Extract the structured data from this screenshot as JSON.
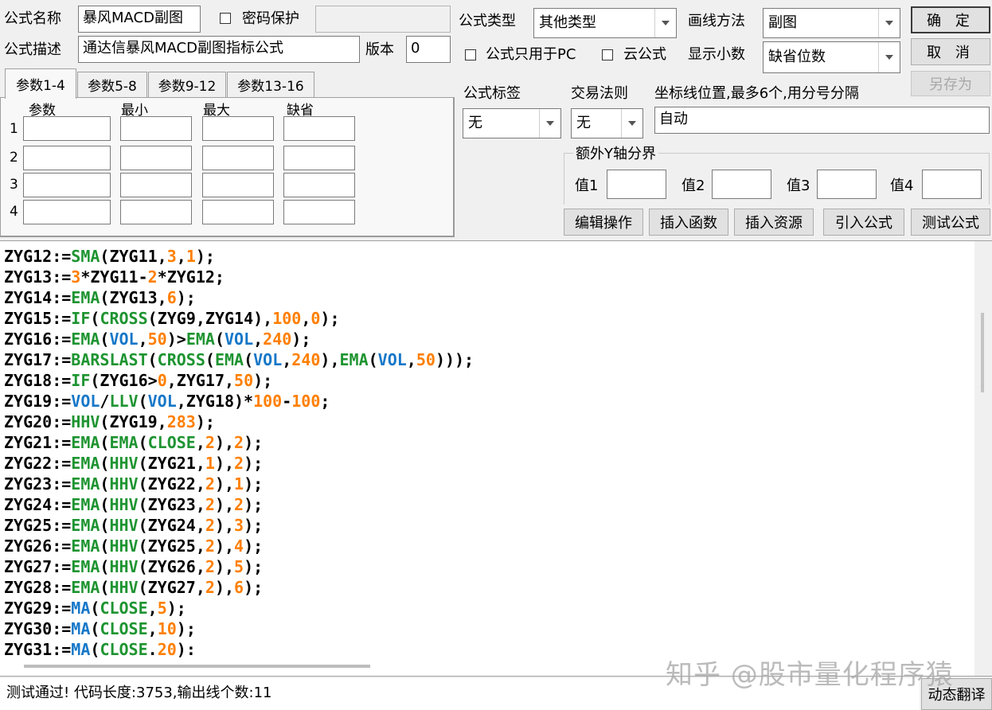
{
  "header": {
    "name_label": "公式名称",
    "name_value": "暴风MACD副图",
    "password_label": "密码保护",
    "password_value": "",
    "desc_label": "公式描述",
    "desc_value": "通达信暴风MACD副图指标公式",
    "version_label": "版本",
    "version_value": "0",
    "type_label": "公式类型",
    "type_value": "其他类型",
    "draw_label": "画线方法",
    "draw_value": "副图",
    "pc_only_label": "公式只用于PC",
    "cloud_label": "云公式",
    "decimal_label": "显示小数",
    "decimal_value": "缺省位数"
  },
  "buttons": {
    "ok": "确 定",
    "cancel": "取 消",
    "save_as": "另存为",
    "edit": "编辑操作",
    "insert_func": "插入函数",
    "insert_res": "插入资源",
    "import": "引入公式",
    "test": "测试公式",
    "translate": "动态翻译"
  },
  "tabs": [
    "参数1-4",
    "参数5-8",
    "参数9-12",
    "参数13-16"
  ],
  "params": {
    "headers": [
      "参数",
      "最小",
      "最大",
      "缺省"
    ],
    "rows": [
      "1",
      "2",
      "3",
      "4"
    ]
  },
  "right": {
    "tag_label": "公式标签",
    "tag_value": "无",
    "rule_label": "交易法则",
    "rule_value": "无",
    "axis_label": "坐标线位置,最多6个,用分号分隔",
    "axis_value": "自动",
    "group_title": "额外Y轴分界",
    "values": [
      "值1",
      "值2",
      "值3",
      "值4"
    ]
  },
  "code_lines": [
    [
      [
        "t",
        "ZYG12:="
      ],
      [
        "f",
        "SMA"
      ],
      [
        "t",
        "(ZYG11,"
      ],
      [
        "n",
        "3"
      ],
      [
        "t",
        ","
      ],
      [
        "n",
        "1"
      ],
      [
        "t",
        ");"
      ]
    ],
    [
      [
        "t",
        "ZYG13:="
      ],
      [
        "n",
        "3"
      ],
      [
        "t",
        "*ZYG11-"
      ],
      [
        "n",
        "2"
      ],
      [
        "t",
        "*ZYG12;"
      ]
    ],
    [
      [
        "t",
        "ZYG14:="
      ],
      [
        "f",
        "EMA"
      ],
      [
        "t",
        "(ZYG13,"
      ],
      [
        "n",
        "6"
      ],
      [
        "t",
        ");"
      ]
    ],
    [
      [
        "t",
        "ZYG15:="
      ],
      [
        "f",
        "IF"
      ],
      [
        "t",
        "("
      ],
      [
        "f",
        "CROSS"
      ],
      [
        "t",
        "(ZYG9,ZYG14),"
      ],
      [
        "n",
        "100"
      ],
      [
        "t",
        ","
      ],
      [
        "n",
        "0"
      ],
      [
        "t",
        ");"
      ]
    ],
    [
      [
        "t",
        "ZYG16:="
      ],
      [
        "f",
        "EMA"
      ],
      [
        "t",
        "("
      ],
      [
        "v",
        "VOL"
      ],
      [
        "t",
        ","
      ],
      [
        "n",
        "50"
      ],
      [
        "t",
        ")>"
      ],
      [
        "f",
        "EMA"
      ],
      [
        "t",
        "("
      ],
      [
        "v",
        "VOL"
      ],
      [
        "t",
        ","
      ],
      [
        "n",
        "240"
      ],
      [
        "t",
        ");"
      ]
    ],
    [
      [
        "t",
        "ZYG17:="
      ],
      [
        "f",
        "BARSLAST"
      ],
      [
        "t",
        "("
      ],
      [
        "f",
        "CROSS"
      ],
      [
        "t",
        "("
      ],
      [
        "f",
        "EMA"
      ],
      [
        "t",
        "("
      ],
      [
        "v",
        "VOL"
      ],
      [
        "t",
        ","
      ],
      [
        "n",
        "240"
      ],
      [
        "t",
        "),"
      ],
      [
        "f",
        "EMA"
      ],
      [
        "t",
        "("
      ],
      [
        "v",
        "VOL"
      ],
      [
        "t",
        ","
      ],
      [
        "n",
        "50"
      ],
      [
        "t",
        ")));"
      ]
    ],
    [
      [
        "t",
        "ZYG18:="
      ],
      [
        "f",
        "IF"
      ],
      [
        "t",
        "(ZYG16>"
      ],
      [
        "n",
        "0"
      ],
      [
        "t",
        ",ZYG17,"
      ],
      [
        "n",
        "50"
      ],
      [
        "t",
        ");"
      ]
    ],
    [
      [
        "t",
        "ZYG19:="
      ],
      [
        "v",
        "VOL"
      ],
      [
        "t",
        "/"
      ],
      [
        "f",
        "LLV"
      ],
      [
        "t",
        "("
      ],
      [
        "v",
        "VOL"
      ],
      [
        "t",
        ",ZYG18)*"
      ],
      [
        "n",
        "100"
      ],
      [
        "t",
        "-"
      ],
      [
        "n",
        "100"
      ],
      [
        "t",
        ";"
      ]
    ],
    [
      [
        "t",
        "ZYG20:="
      ],
      [
        "f",
        "HHV"
      ],
      [
        "t",
        "(ZYG19,"
      ],
      [
        "n",
        "283"
      ],
      [
        "t",
        ");"
      ]
    ],
    [
      [
        "t",
        "ZYG21:="
      ],
      [
        "f",
        "EMA"
      ],
      [
        "t",
        "("
      ],
      [
        "f",
        "EMA"
      ],
      [
        "t",
        "("
      ],
      [
        "f",
        "CLOSE"
      ],
      [
        "t",
        ","
      ],
      [
        "n",
        "2"
      ],
      [
        "t",
        "),"
      ],
      [
        "n",
        "2"
      ],
      [
        "t",
        ");"
      ]
    ],
    [
      [
        "t",
        "ZYG22:="
      ],
      [
        "f",
        "EMA"
      ],
      [
        "t",
        "("
      ],
      [
        "f",
        "HHV"
      ],
      [
        "t",
        "(ZYG21,"
      ],
      [
        "n",
        "1"
      ],
      [
        "t",
        "),"
      ],
      [
        "n",
        "2"
      ],
      [
        "t",
        ");"
      ]
    ],
    [
      [
        "t",
        "ZYG23:="
      ],
      [
        "f",
        "EMA"
      ],
      [
        "t",
        "("
      ],
      [
        "f",
        "HHV"
      ],
      [
        "t",
        "(ZYG22,"
      ],
      [
        "n",
        "2"
      ],
      [
        "t",
        "),"
      ],
      [
        "n",
        "1"
      ],
      [
        "t",
        ");"
      ]
    ],
    [
      [
        "t",
        "ZYG24:="
      ],
      [
        "f",
        "EMA"
      ],
      [
        "t",
        "("
      ],
      [
        "f",
        "HHV"
      ],
      [
        "t",
        "(ZYG23,"
      ],
      [
        "n",
        "2"
      ],
      [
        "t",
        "),"
      ],
      [
        "n",
        "2"
      ],
      [
        "t",
        ");"
      ]
    ],
    [
      [
        "t",
        "ZYG25:="
      ],
      [
        "f",
        "EMA"
      ],
      [
        "t",
        "("
      ],
      [
        "f",
        "HHV"
      ],
      [
        "t",
        "(ZYG24,"
      ],
      [
        "n",
        "2"
      ],
      [
        "t",
        "),"
      ],
      [
        "n",
        "3"
      ],
      [
        "t",
        ");"
      ]
    ],
    [
      [
        "t",
        "ZYG26:="
      ],
      [
        "f",
        "EMA"
      ],
      [
        "t",
        "("
      ],
      [
        "f",
        "HHV"
      ],
      [
        "t",
        "(ZYG25,"
      ],
      [
        "n",
        "2"
      ],
      [
        "t",
        "),"
      ],
      [
        "n",
        "4"
      ],
      [
        "t",
        ");"
      ]
    ],
    [
      [
        "t",
        "ZYG27:="
      ],
      [
        "f",
        "EMA"
      ],
      [
        "t",
        "("
      ],
      [
        "f",
        "HHV"
      ],
      [
        "t",
        "(ZYG26,"
      ],
      [
        "n",
        "2"
      ],
      [
        "t",
        "),"
      ],
      [
        "n",
        "5"
      ],
      [
        "t",
        ");"
      ]
    ],
    [
      [
        "t",
        "ZYG28:="
      ],
      [
        "f",
        "EMA"
      ],
      [
        "t",
        "("
      ],
      [
        "f",
        "HHV"
      ],
      [
        "t",
        "(ZYG27,"
      ],
      [
        "n",
        "2"
      ],
      [
        "t",
        "),"
      ],
      [
        "n",
        "6"
      ],
      [
        "t",
        ");"
      ]
    ],
    [
      [
        "t",
        "ZYG29:="
      ],
      [
        "v",
        "MA"
      ],
      [
        "t",
        "("
      ],
      [
        "f",
        "CLOSE"
      ],
      [
        "t",
        ","
      ],
      [
        "n",
        "5"
      ],
      [
        "t",
        ");"
      ]
    ],
    [
      [
        "t",
        "ZYG30:="
      ],
      [
        "v",
        "MA"
      ],
      [
        "t",
        "("
      ],
      [
        "f",
        "CLOSE"
      ],
      [
        "t",
        ","
      ],
      [
        "n",
        "10"
      ],
      [
        "t",
        ");"
      ]
    ],
    [
      [
        "t",
        "ZYG31:="
      ],
      [
        "v",
        "MA"
      ],
      [
        "t",
        "("
      ],
      [
        "f",
        "CLOSE"
      ],
      [
        "t",
        "."
      ],
      [
        "n",
        "20"
      ],
      [
        "t",
        "):"
      ]
    ]
  ],
  "status": "测试通过! 代码长度:3753,输出线个数:11",
  "watermark": "知乎 @股市量化程序猿",
  "colors": {
    "function": "#1e9431",
    "number": "#ff7f00",
    "variable": "#1677c8",
    "background": "#f0f0f0"
  }
}
